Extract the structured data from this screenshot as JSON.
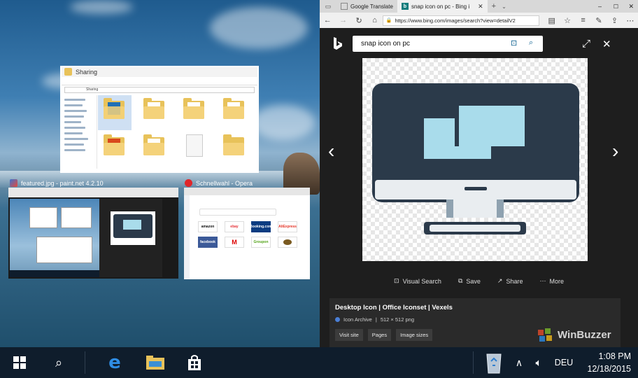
{
  "desktop": {
    "explorer_thumb": {
      "title": "Sharing",
      "address": "Sharing"
    },
    "paint_thumb": {
      "title": "featured.jpg - paint.net 4.2.10"
    },
    "opera_thumb": {
      "title": "Schnellwahl - Opera",
      "speed_dial": [
        "amazon",
        "ebay",
        "Booking.com",
        "AliExpress",
        "facebook",
        "",
        "Groupon",
        ""
      ]
    }
  },
  "browser": {
    "tabs": [
      {
        "label": "Google Translate"
      },
      {
        "label": "snap icon on pc - Bing i"
      }
    ],
    "url": "https://www.bing.com/images/search?view=detailV2",
    "search_query": "snap icon on pc",
    "actions": [
      "Visual Search",
      "Save",
      "Share",
      "More"
    ],
    "details": {
      "title": "Desktop Icon | Office Iconset | Vexels",
      "source": "Icon Archive",
      "sep": "|",
      "size": "512 × 512 png",
      "buttons": [
        "Visit site",
        "Pages",
        "Image sizes"
      ]
    }
  },
  "watermark": "WinBuzzer",
  "taskbar": {
    "language": "DEU",
    "time": "1:08 PM",
    "date": "12/18/2015"
  },
  "colors": {
    "accent": "#2b3a4a",
    "screen": "#a9dceb",
    "bing_blue": "#0a5f8f"
  }
}
